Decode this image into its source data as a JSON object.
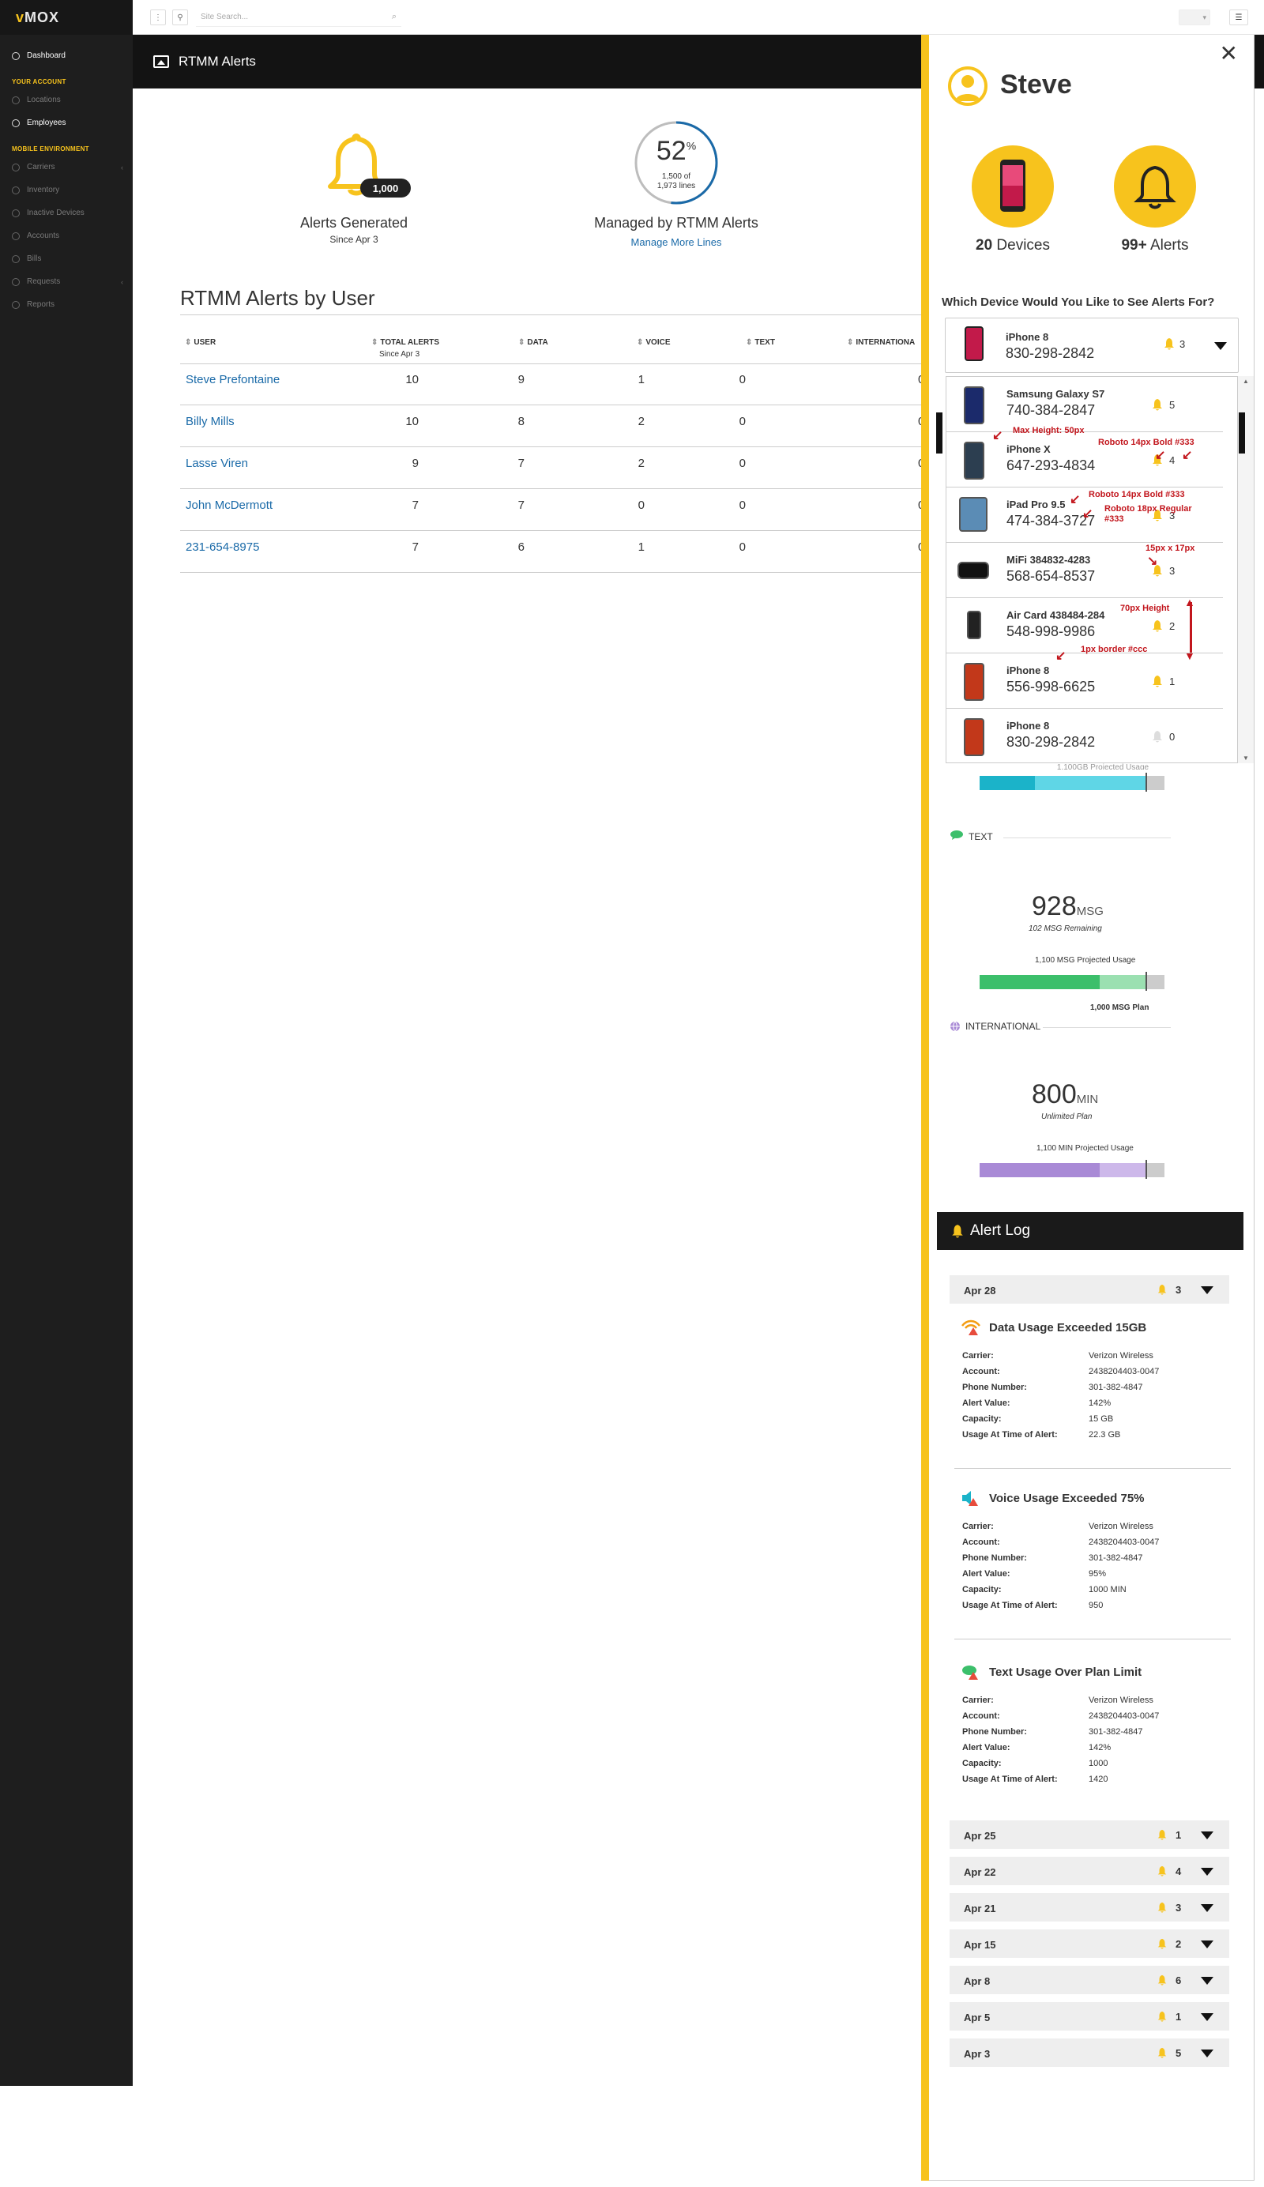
{
  "brand": {
    "prefix": "v",
    "name": "MOX"
  },
  "sidebar": {
    "dashboard": "Dashboard",
    "section_account": "YOUR ACCOUNT",
    "locations": "Locations",
    "employees": "Employees",
    "section_mobile": "MOBILE ENVIRONMENT",
    "carriers": "Carriers",
    "inventory": "Inventory",
    "inactive": "Inactive Devices",
    "accounts": "Accounts",
    "bills": "Bills",
    "requests": "Requests",
    "reports": "Reports"
  },
  "topbar": {
    "search_placeholder": "Site Search..."
  },
  "page": {
    "title": "RTMM Alerts"
  },
  "stats": {
    "alerts_badge": "1,000",
    "alerts_title": "Alerts Generated",
    "alerts_since": "Since Apr 3",
    "managed_pct": "52",
    "managed_pct_sign": "%",
    "managed_sub1": "1,500 of",
    "managed_sub2": "1,973 lines",
    "managed_fraction": 0.52,
    "managed_title": "Managed by RTMM Alerts",
    "manage_link": "Manage More Lines"
  },
  "table": {
    "title": "RTMM Alerts by User",
    "headers": {
      "user": "USER",
      "total": "TOTAL ALERTS",
      "total_sub": "Since Apr 3",
      "data": "DATA",
      "voice": "VOICE",
      "text": "TEXT",
      "intl": "INTERNATIONA"
    },
    "rows": [
      {
        "user": "Steve Prefontaine",
        "total": "10",
        "data": "9",
        "voice": "1",
        "text": "0",
        "intl": "0"
      },
      {
        "user": "Billy Mills",
        "total": "10",
        "data": "8",
        "voice": "2",
        "text": "0",
        "intl": "0"
      },
      {
        "user": "Lasse Viren",
        "total": "9",
        "data": "7",
        "voice": "2",
        "text": "0",
        "intl": "0"
      },
      {
        "user": "John McDermott",
        "total": "7",
        "data": "7",
        "voice": "0",
        "text": "0",
        "intl": "0"
      },
      {
        "user": "231-654-8975",
        "total": "7",
        "data": "6",
        "voice": "1",
        "text": "0",
        "intl": "0"
      }
    ]
  },
  "panel": {
    "name": "Steve",
    "devices_count": "20",
    "devices_label": "Devices",
    "alerts_count": "99+",
    "alerts_label": "Alerts",
    "question": "Which Device Would You Like to See Alerts For?",
    "selected": {
      "name": "iPhone 8",
      "number": "830-298-2842",
      "count": "3"
    },
    "devices": [
      {
        "name": "Samsung Galaxy S7",
        "number": "740-384-2847",
        "count": "5"
      },
      {
        "name": "iPhone X",
        "number": "647-293-4834",
        "count": "4"
      },
      {
        "name": "iPad Pro 9.5",
        "number": "474-384-3727",
        "count": "3"
      },
      {
        "name": "MiFi 384832-4283",
        "number": "568-654-8537",
        "count": "3"
      },
      {
        "name": "Air Card 438484-284",
        "number": "548-998-9986",
        "count": "2"
      },
      {
        "name": "iPhone 8",
        "number": "556-998-6625",
        "count": "1"
      },
      {
        "name": "iPhone 8",
        "number": "830-298-2842",
        "count": "0"
      }
    ],
    "annotations": {
      "max_height": "Max Height: 50px",
      "bold_font": "Roboto 14px Bold #333",
      "bold_font2": "Roboto 14px Bold #333",
      "regular_font_1": "Roboto 18px Regular",
      "regular_font_2": "#333",
      "icon_size": "15px x 17px",
      "row_height": "70px Height",
      "border": "1px border #ccc"
    },
    "data_usage_partial": "1,100GB Projected Usage",
    "text_usage": {
      "label": "TEXT",
      "value": "928",
      "unit": "MSG",
      "remaining": "102 MSG Remaining",
      "projected": "1,100 MSG Projected Usage",
      "plan": "1,000 MSG Plan",
      "used_fraction": 0.65,
      "projected_fraction": 0.9
    },
    "intl_usage": {
      "label": "INTERNATIONAL",
      "value": "800",
      "unit": "MIN",
      "remaining": "Unlimited Plan",
      "projected": "1,100 MIN Projected Usage",
      "used_fraction": 0.65,
      "projected_fraction": 0.9
    },
    "data_usage_bar": {
      "used_fraction": 0.3,
      "projected_fraction": 0.9
    },
    "alert_log_title": "Alert Log",
    "log_days_top": {
      "date": "Apr 28",
      "count": "3"
    },
    "alerts": [
      {
        "title": "Data Usage Exceeded 15GB",
        "carrier": "Verizon Wireless",
        "account": "2438204403-0047",
        "phone": "301-382-4847",
        "alert_value": "142%",
        "capacity": "15 GB",
        "usage": "22.3 GB"
      },
      {
        "title": "Voice Usage Exceeded 75%",
        "carrier": "Verizon Wireless",
        "account": "2438204403-0047",
        "phone": "301-382-4847",
        "alert_value": "95%",
        "capacity": "1000 MIN",
        "usage": "950"
      },
      {
        "title": "Text Usage Over Plan Limit",
        "carrier": "Verizon Wireless",
        "account": "2438204403-0047",
        "phone": "301-382-4847",
        "alert_value": "142%",
        "capacity": "1000",
        "usage": "1420"
      }
    ],
    "alert_keys": {
      "carrier": "Carrier:",
      "account": "Account:",
      "phone": "Phone Number:",
      "alert_value": "Alert Value:",
      "capacity": "Capacity:",
      "usage": "Usage At Time of Alert:"
    },
    "log_days": [
      {
        "date": "Apr 25",
        "count": "1"
      },
      {
        "date": "Apr 22",
        "count": "4"
      },
      {
        "date": "Apr 21",
        "count": "3"
      },
      {
        "date": "Apr 15",
        "count": "2"
      },
      {
        "date": "Apr 8",
        "count": "6"
      },
      {
        "date": "Apr 5",
        "count": "1"
      },
      {
        "date": "Apr 3",
        "count": "5"
      }
    ]
  },
  "colors": {
    "accent": "#f7c31d",
    "link": "#1a6aa8",
    "text_green": "#3cbf6b",
    "text_green_light": "#9be0b1",
    "intl_purple": "#a98ad6",
    "intl_purple_light": "#cdb8ea",
    "data_teal": "#1bb3c9",
    "data_teal_light": "#5fd6e6",
    "annotation": "#c2161d"
  }
}
